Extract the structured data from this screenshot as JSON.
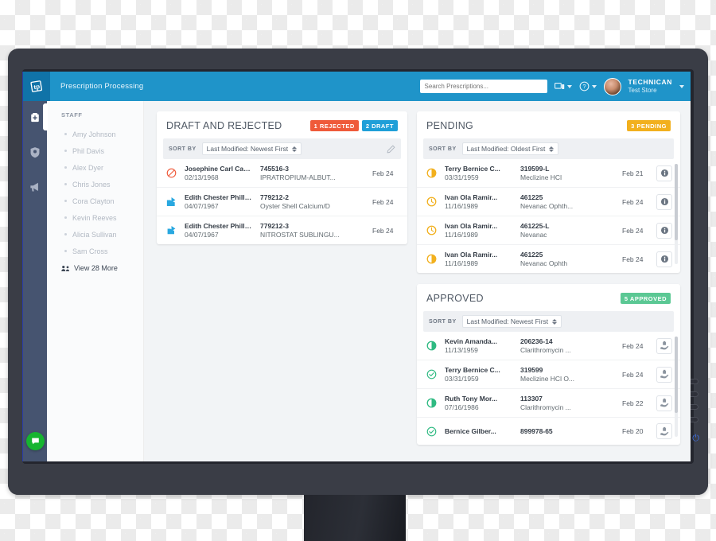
{
  "app": {
    "title": "Prescription Processing",
    "logo_icon": "tp-logo-icon"
  },
  "header": {
    "search": {
      "placeholder": "Search Prescriptions...",
      "value": ""
    },
    "device_icon": "device-screen-icon",
    "help_icon": "question-circle-icon",
    "user": {
      "name": "TECHNICAN",
      "store": "Test Store"
    }
  },
  "rail": {
    "items": [
      {
        "icon": "pharmacy-bag-icon",
        "active": true
      },
      {
        "icon": "shield-icon",
        "active": false
      },
      {
        "icon": "megaphone-icon",
        "active": false
      }
    ],
    "chat_icon": "chat-bubble-icon"
  },
  "sidebar": {
    "heading": "STAFF",
    "items": [
      {
        "label": "Amy Johnson"
      },
      {
        "label": "Phil Davis"
      },
      {
        "label": "Alex Dyer"
      },
      {
        "label": "Chris Jones"
      },
      {
        "label": "Cora Clayton"
      },
      {
        "label": "Kevin Reeves"
      },
      {
        "label": "Alicia Sullivan"
      },
      {
        "label": "Sam Cross"
      }
    ],
    "view_more": {
      "label": "View 28 More",
      "icon": "people-icon"
    }
  },
  "colors": {
    "header_blue": "#1f94c9",
    "logo_blue": "#1073a8",
    "rail_navy": "#465470",
    "rejected_red": "#ef5a3a",
    "draft_blue": "#1f9fd8",
    "pending_amber": "#f2b01e",
    "approved_green": "#5bc894",
    "chat_green": "#16b530"
  },
  "cards": {
    "draft_rejected": {
      "title": "DRAFT AND REJECTED",
      "badges": [
        {
          "label": "1 REJECTED",
          "kind": "rejected"
        },
        {
          "label": "2 DRAFT",
          "kind": "draft"
        }
      ],
      "sort": {
        "label": "SORT BY",
        "value": "Last Modified: Newest First"
      },
      "edit_icon": "pencil-icon",
      "rows": [
        {
          "status_icon": "blocked-icon",
          "patient": "Josephine Carl Castil...",
          "dob": "02/13/1968",
          "rx_number": "745516-3",
          "drug": "IPRATROPIUM-ALBUT...",
          "date": "Feb 24"
        },
        {
          "status_icon": "share-square-icon",
          "patient": "Edith Chester Phillips",
          "dob": "04/07/1967",
          "rx_number": "779212-2",
          "drug": "Oyster Shell Calcium/D",
          "date": "Feb 24"
        },
        {
          "status_icon": "share-square-icon",
          "patient": "Edith Chester Phillips",
          "dob": "04/07/1967",
          "rx_number": "779212-3",
          "drug": "NITROSTAT SUBLINGU...",
          "date": "Feb 24"
        }
      ]
    },
    "pending": {
      "title": "PENDING",
      "badges": [
        {
          "label": "3 PENDING",
          "kind": "pending"
        }
      ],
      "sort": {
        "label": "SORT BY",
        "value": "Last Modified: Oldest First"
      },
      "rows": [
        {
          "status_icon": "half-circle-icon",
          "patient": "Terry Bernice C...",
          "dob": "03/31/1959",
          "rx_number": "319599-L",
          "drug": "Meclizine HCl",
          "date": "Feb 21",
          "action_icon": "info-icon"
        },
        {
          "status_icon": "clock-icon",
          "patient": "Ivan Ola Ramir...",
          "dob": "11/16/1989",
          "rx_number": "461225",
          "drug": "Nevanac Ophth...",
          "date": "Feb 24",
          "action_icon": "info-icon"
        },
        {
          "status_icon": "clock-icon",
          "patient": "Ivan Ola Ramir...",
          "dob": "11/16/1989",
          "rx_number": "461225-L",
          "drug": "Nevanac",
          "date": "Feb 24",
          "action_icon": "info-icon"
        },
        {
          "status_icon": "half-circle-icon",
          "patient": "Ivan Ola Ramir...",
          "dob": "11/16/1989",
          "rx_number": "461225",
          "drug": "Nevanac Ophth",
          "date": "Feb 24",
          "action_icon": "info-icon"
        }
      ]
    },
    "approved": {
      "title": "APPROVED",
      "badges": [
        {
          "label": "5 APPROVED",
          "kind": "approved"
        }
      ],
      "sort": {
        "label": "SORT BY",
        "value": "Last Modified: Newest First"
      },
      "rows": [
        {
          "status_icon": "half-circle-icon",
          "patient": "Kevin Amanda...",
          "dob": "11/13/1959",
          "rx_number": "206236-14",
          "drug": "Clarithromycin ...",
          "date": "Feb 24",
          "action_icon": "dispense-hand-icon"
        },
        {
          "status_icon": "check-circle-icon",
          "patient": "Terry Bernice C...",
          "dob": "03/31/1959",
          "rx_number": "319599",
          "drug": "Meclizine HCl O...",
          "date": "Feb 24",
          "action_icon": "dispense-hand-icon"
        },
        {
          "status_icon": "half-circle-icon",
          "patient": "Ruth Tony Mor...",
          "dob": "07/16/1986",
          "rx_number": "113307",
          "drug": "Clarithromycin ...",
          "date": "Feb 22",
          "action_icon": "dispense-hand-icon"
        },
        {
          "status_icon": "check-circle-icon",
          "patient": "Bernice Gilber...",
          "dob": "",
          "rx_number": "899978-65",
          "drug": "",
          "date": "Feb 20",
          "action_icon": "dispense-hand-icon"
        }
      ]
    }
  },
  "monitor": {
    "bezel_buttons": 4,
    "power_icon": "power-icon"
  }
}
